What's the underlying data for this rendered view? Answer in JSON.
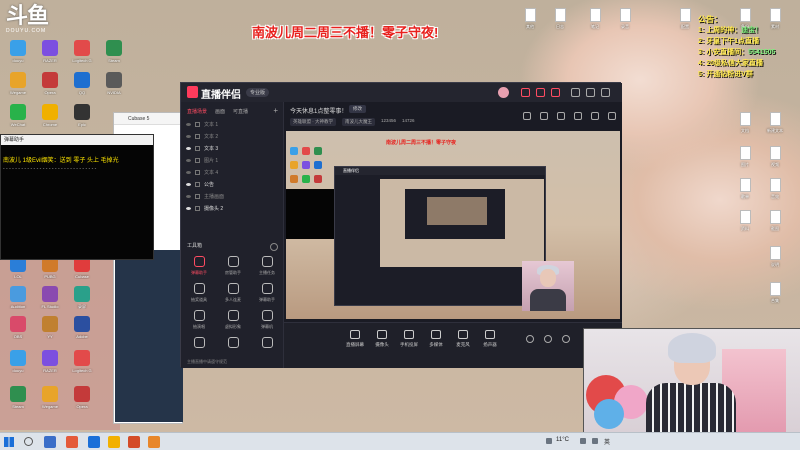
{
  "logo": {
    "mark": "斗鱼",
    "sub": "DOUYU.COM"
  },
  "banner": "南波儿周二周三不播！零子守夜!",
  "notice": {
    "title": "公告：",
    "lines": [
      {
        "num": "1:",
        "text": "上周的神：",
        "highlight": "迪宝！"
      },
      {
        "num": "2:",
        "text": "牙皇下午1点直播",
        "highlight": ""
      },
      {
        "num": "3:",
        "text": "小安直播间：",
        "highlight": "5541505"
      },
      {
        "num": "4:",
        "text": "20级私信大家直播",
        "highlight": ""
      },
      {
        "num": "5:",
        "text": "开通钻粉进V群",
        "highlight": ""
      }
    ]
  },
  "chat_window": {
    "title": "弹幕助手",
    "message": "南波儿 1级Evil烟笑：送到 零子 头上 毛掉光",
    "divider": "- - - - - - - - - - - - - - - - - - - - - - - - - - - - - - -"
  },
  "cubase": {
    "title": "Cubase 5"
  },
  "app": {
    "title": "直播伴侣",
    "badge": "专业版",
    "left_tabs": [
      "直播场景",
      "画面",
      "可直播"
    ],
    "sources": [
      {
        "label": "文本 1",
        "on": false
      },
      {
        "label": "文本 2",
        "on": false
      },
      {
        "label": "文本 3",
        "on": true
      },
      {
        "label": "图片 1",
        "on": false
      },
      {
        "label": "文本 4",
        "on": false
      },
      {
        "label": "公告",
        "on": true
      },
      {
        "label": "主播画面",
        "on": false
      },
      {
        "label": "摄像头 2",
        "on": true
      }
    ],
    "tools_title": "工具箱",
    "tools": [
      {
        "label": "弹幕助手",
        "active": true
      },
      {
        "label": "房管助手",
        "active": false
      },
      {
        "label": "主播任务",
        "active": false
      },
      {
        "label": "抽奖道具",
        "active": false
      },
      {
        "label": "多人连麦",
        "active": false
      },
      {
        "label": "弹幕助手",
        "active": false
      },
      {
        "label": "抽演唱",
        "active": false
      },
      {
        "label": "虚拟形象",
        "active": false
      },
      {
        "label": "弹幕机",
        "active": false
      },
      {
        "label": "",
        "active": false
      },
      {
        "label": "",
        "active": false
      },
      {
        "label": "",
        "active": false
      }
    ],
    "footer": "主播直播中请遵守规范",
    "live_title": "今天休息1点整零事！",
    "edit_label": "修改",
    "tags": [
      "英雄联盟 · 大神教学",
      "南波儿大魔王"
    ],
    "stats": [
      "123456",
      "14726"
    ],
    "bottom_items": [
      "直播屏幕",
      "摄像头",
      "手机投屏",
      "多媒体",
      "麦克风",
      "扬声器"
    ]
  },
  "preview_banner": "南波儿周二周三不播！零子守夜",
  "taskbar": {
    "weather": "11°C",
    "tray_text": "英"
  },
  "desktop_labels": [
    "douyu",
    "RAZER",
    "Logitech G",
    "Steam",
    "Wegame",
    "Opera",
    "QQ",
    "NVIDIA",
    "WeChat",
    "Chrome",
    "Epic",
    "LOL",
    "PUBG",
    "Cubase",
    "Audition",
    "FL Studio",
    "录屏",
    "OBS",
    "YY",
    "Adobe"
  ],
  "file_labels": [
    "文档",
    "新建文本",
    "图片",
    "视频",
    "歌单",
    "音效",
    "资料",
    "截图",
    "说明",
    "合集",
    "备份",
    "素材",
    "配置",
    "录音",
    "笔记",
    "日志",
    "其他"
  ]
}
